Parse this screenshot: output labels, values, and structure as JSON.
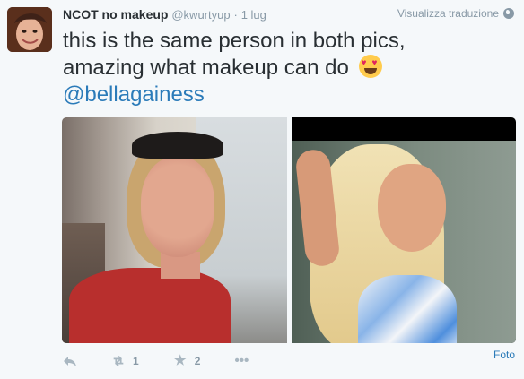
{
  "tweet": {
    "name": "NCOT no makeup",
    "handle": "@kwurtyup",
    "separator": "·",
    "time": "1 lug",
    "translate_label": "Visualizza traduzione",
    "text_line1": "this is the same person in both pics,",
    "text_line2": "amazing what makeup can do",
    "mention": "@bellagainess",
    "media_label": "Foto",
    "retweet_count": "1",
    "favorite_count": "2",
    "more_label": "•••"
  },
  "colors": {
    "link": "#2b7bb9",
    "muted": "#8899a6",
    "text": "#292f33",
    "background": "#f5f8fa"
  },
  "icons": {
    "reply": "reply-icon",
    "retweet": "retweet-icon",
    "favorite": "star-icon",
    "more": "more-icon",
    "translate": "globe-icon",
    "emoji": "heart-eyes-emoji-icon"
  }
}
